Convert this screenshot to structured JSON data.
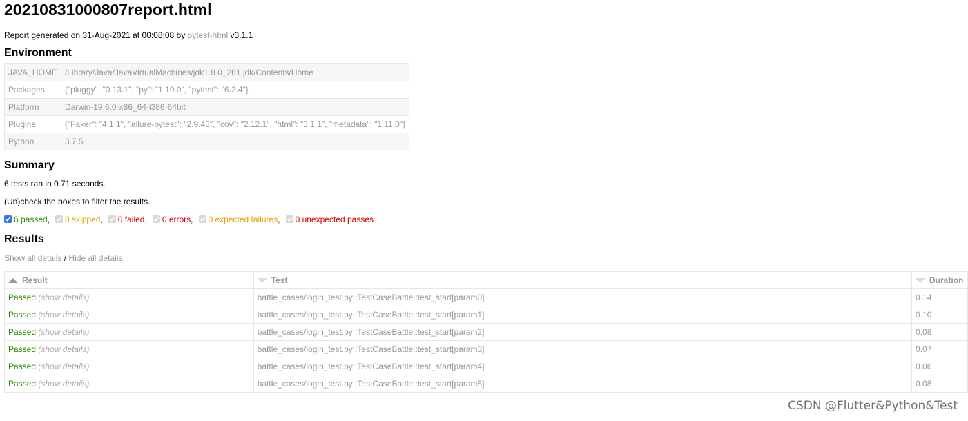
{
  "title": "20210831000807report.html",
  "generated": {
    "prefix": "Report generated on 31-Aug-2021 at 00:08:08 by ",
    "link": "pytest-html",
    "suffix": " v3.1.1"
  },
  "environment": {
    "heading": "Environment",
    "rows": [
      {
        "key": "JAVA_HOME",
        "value": "/Library/Java/JavaVirtualMachines/jdk1.8.0_261.jdk/Contents/Home"
      },
      {
        "key": "Packages",
        "value": "{\"pluggy\": \"0.13.1\", \"py\": \"1.10.0\", \"pytest\": \"6.2.4\"}"
      },
      {
        "key": "Platform",
        "value": "Darwin-19.6.0-x86_64-i386-64bit"
      },
      {
        "key": "Plugins",
        "value": "{\"Faker\": \"4.1.1\", \"allure-pytest\": \"2.9.43\", \"cov\": \"2.12.1\", \"html\": \"3.1.1\", \"metadata\": \"1.11.0\"}"
      },
      {
        "key": "Python",
        "value": "3.7.5"
      }
    ]
  },
  "summary": {
    "heading": "Summary",
    "line1": "6 tests ran in 0.71 seconds.",
    "line2": "(Un)check the boxes to filter the results.",
    "filters": [
      {
        "label": "6 passed",
        "checked": true,
        "color": "#2a8c00"
      },
      {
        "label": "0 skipped",
        "checked": false,
        "color": "#e8a100"
      },
      {
        "label": "0 failed",
        "checked": false,
        "color": "#d90000"
      },
      {
        "label": "0 errors",
        "checked": false,
        "color": "#d90000"
      },
      {
        "label": "0 expected failures",
        "checked": false,
        "color": "#e8a100"
      },
      {
        "label": "0 unexpected passes",
        "checked": false,
        "color": "#d90000"
      }
    ]
  },
  "results": {
    "heading": "Results",
    "show_all": "Show all details",
    "slash": "/",
    "hide_all": "Hide all details",
    "columns": {
      "result": "Result",
      "test": "Test",
      "duration": "Duration"
    },
    "rows": [
      {
        "result": "Passed",
        "details": "(show details)",
        "test": "battle_cases/login_test.py::TestCaseBattle::test_start[param0]",
        "duration": "0.14"
      },
      {
        "result": "Passed",
        "details": "(show details)",
        "test": "battle_cases/login_test.py::TestCaseBattle::test_start[param1]",
        "duration": "0.10"
      },
      {
        "result": "Passed",
        "details": "(show details)",
        "test": "battle_cases/login_test.py::TestCaseBattle::test_start[param2]",
        "duration": "0.08"
      },
      {
        "result": "Passed",
        "details": "(show details)",
        "test": "battle_cases/login_test.py::TestCaseBattle::test_start[param3]",
        "duration": "0.07"
      },
      {
        "result": "Passed",
        "details": "(show details)",
        "test": "battle_cases/login_test.py::TestCaseBattle::test_start[param4]",
        "duration": "0.06"
      },
      {
        "result": "Passed",
        "details": "(show details)",
        "test": "battle_cases/login_test.py::TestCaseBattle::test_start[param5]",
        "duration": "0.08"
      }
    ]
  },
  "watermark": "CSDN @Flutter&Python&Test"
}
